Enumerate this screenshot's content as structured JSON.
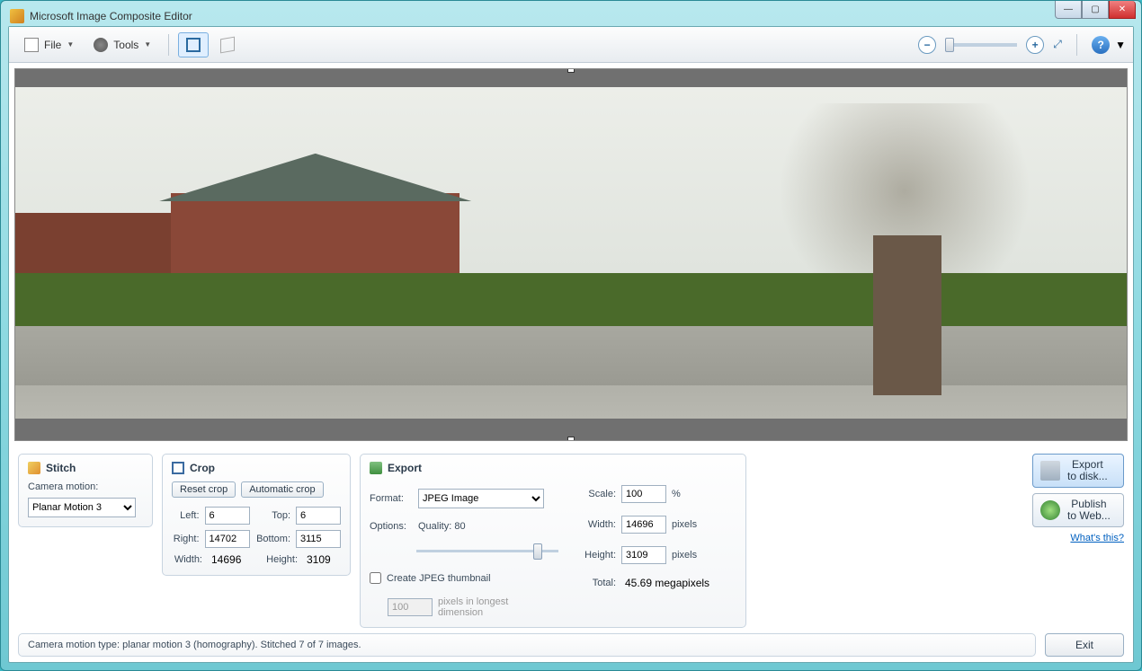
{
  "window": {
    "title": "Microsoft Image Composite Editor"
  },
  "toolbar": {
    "file_label": "File",
    "tools_label": "Tools"
  },
  "stitch": {
    "title": "Stitch",
    "camera_label": "Camera motion:",
    "camera_value": "Planar Motion 3"
  },
  "crop": {
    "title": "Crop",
    "reset_label": "Reset crop",
    "auto_label": "Automatic crop",
    "left_label": "Left:",
    "left": "6",
    "top_label": "Top:",
    "top": "6",
    "right_label": "Right:",
    "right": "14702",
    "bottom_label": "Bottom:",
    "bottom": "3115",
    "width_label": "Width:",
    "width": "14696",
    "height_label": "Height:",
    "height": "3109"
  },
  "export": {
    "title": "Export",
    "format_label": "Format:",
    "format_value": "JPEG Image",
    "options_label": "Options:",
    "quality_label": "Quality: 80",
    "thumb_label": "Create JPEG thumbnail",
    "thumb_px": "100",
    "thumb_px_label": "pixels in longest dimension",
    "scale_label": "Scale:",
    "scale": "100",
    "scale_unit": "%",
    "width_label": "Width:",
    "width": "14696",
    "height_label": "Height:",
    "height": "3109",
    "px_unit": "pixels",
    "total_label": "Total:",
    "total_value": "45.69 megapixels"
  },
  "actions": {
    "export_disk_l1": "Export",
    "export_disk_l2": "to disk...",
    "publish_l1": "Publish",
    "publish_l2": "to Web...",
    "whats_this": "What's this?",
    "exit": "Exit"
  },
  "status": {
    "text": "Camera motion type: planar motion 3 (homography). Stitched 7 of 7 images."
  }
}
